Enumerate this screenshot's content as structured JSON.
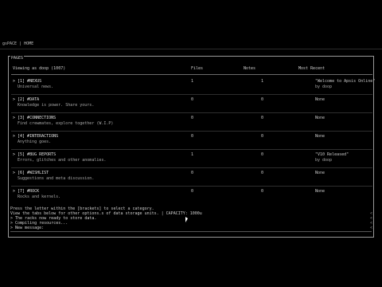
{
  "topbar": {
    "title": "gsPACE | HOME"
  },
  "panel": {
    "title": "PAGES",
    "viewing": "Viewing as doop (1007)",
    "columns": {
      "files": "Files",
      "notes": "Notes",
      "recent": "Most Recent"
    }
  },
  "rows": [
    {
      "name": "> [1] #NEXUS",
      "desc": "Universal news.",
      "files": "1",
      "notes": "1",
      "recent": "\"Welcome to Apsis Online\"",
      "recent2": "by doop"
    },
    {
      "name": "> [2] #DATA",
      "desc": "Knowledge is power. Share yours.",
      "files": "0",
      "notes": "0",
      "recent": "None",
      "recent2": ""
    },
    {
      "name": "> [3] #CONNECTIONS",
      "desc": "Find crewmates, explore together (W.I.P)",
      "files": "0",
      "notes": "0",
      "recent": "None",
      "recent2": ""
    },
    {
      "name": "> [4] #INTERACTIONS",
      "desc": "Anything goes.",
      "files": "0",
      "notes": "0",
      "recent": "None",
      "recent2": ""
    },
    {
      "name": "> [5] #BUG REPORTS",
      "desc": "Errors, glitches and other anomalies.",
      "files": "1",
      "notes": "0",
      "recent": "\"V10 Released\"",
      "recent2": "by doop"
    },
    {
      "name": "> [6] #WISHLIST",
      "desc": "Suggestions and meta discussion.",
      "files": "0",
      "notes": "0",
      "recent": "None",
      "recent2": ""
    },
    {
      "name": "> [7] #ROCK",
      "desc": "Rocks and kernels.",
      "files": "0",
      "notes": "0",
      "recent": "None",
      "recent2": ""
    }
  ],
  "console": {
    "line1": "Press the letter within the [brackets] to select a category.",
    "line2": "View the tabs below for other options.s of data storage units. | CAPACITY: 1000u",
    "line3": "> The racks now ready to store data.",
    "line4": "> Compiling resources...",
    "line5": "> New message:"
  }
}
